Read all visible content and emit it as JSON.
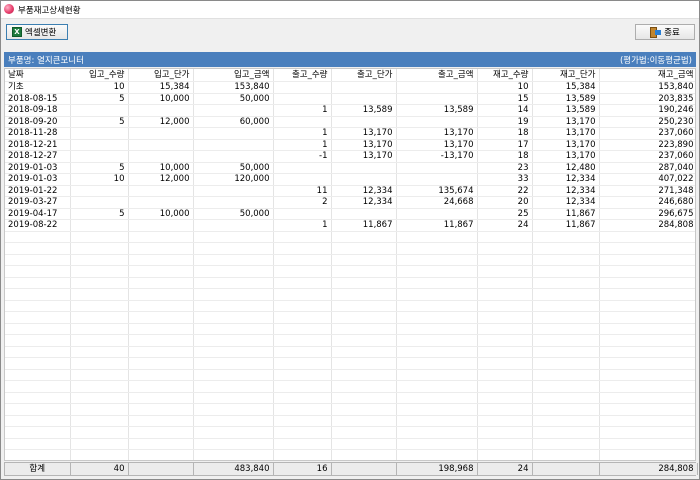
{
  "window": {
    "title": "부품재고상세현황"
  },
  "toolbar": {
    "excel_label": "엑셀변환",
    "close_label": "종료"
  },
  "info": {
    "part_label": "부품명: 열지큰모니터",
    "method_label": "(평가법:이동평균법)"
  },
  "grid": {
    "columns": [
      "날짜",
      "입고_수량",
      "입고_단가",
      "입고_금액",
      "출고_수량",
      "출고_단가",
      "출고_금액",
      "재고_수량",
      "재고_단가",
      "재고_금액"
    ],
    "rows": [
      [
        "기초",
        "10",
        "15,384",
        "153,840",
        "",
        "",
        "",
        "10",
        "15,384",
        "153,840"
      ],
      [
        "2018-08-15",
        "5",
        "10,000",
        "50,000",
        "",
        "",
        "",
        "15",
        "13,589",
        "203,835"
      ],
      [
        "2018-09-18",
        "",
        "",
        "",
        "1",
        "13,589",
        "13,589",
        "14",
        "13,589",
        "190,246"
      ],
      [
        "2018-09-20",
        "5",
        "12,000",
        "60,000",
        "",
        "",
        "",
        "19",
        "13,170",
        "250,230"
      ],
      [
        "2018-11-28",
        "",
        "",
        "",
        "1",
        "13,170",
        "13,170",
        "18",
        "13,170",
        "237,060"
      ],
      [
        "2018-12-21",
        "",
        "",
        "",
        "1",
        "13,170",
        "13,170",
        "17",
        "13,170",
        "223,890"
      ],
      [
        "2018-12-27",
        "",
        "",
        "",
        "-1",
        "13,170",
        "-13,170",
        "18",
        "13,170",
        "237,060"
      ],
      [
        "2019-01-03",
        "5",
        "10,000",
        "50,000",
        "",
        "",
        "",
        "23",
        "12,480",
        "287,040"
      ],
      [
        "2019-01-03",
        "10",
        "12,000",
        "120,000",
        "",
        "",
        "",
        "33",
        "12,334",
        "407,022"
      ],
      [
        "2019-01-22",
        "",
        "",
        "",
        "11",
        "12,334",
        "135,674",
        "22",
        "12,334",
        "271,348"
      ],
      [
        "2019-03-27",
        "",
        "",
        "",
        "2",
        "12,334",
        "24,668",
        "20",
        "12,334",
        "246,680"
      ],
      [
        "2019-04-17",
        "5",
        "10,000",
        "50,000",
        "",
        "",
        "",
        "25",
        "11,867",
        "296,675"
      ],
      [
        "2019-08-22",
        "",
        "",
        "",
        "1",
        "11,867",
        "11,867",
        "24",
        "11,867",
        "284,808"
      ]
    ]
  },
  "footer": {
    "label": "합계",
    "cells": [
      "40",
      "",
      "483,840",
      "16",
      "",
      "198,968",
      "24",
      "",
      "284,808"
    ]
  },
  "colors": {
    "header_blue": "#4a7fbd"
  }
}
